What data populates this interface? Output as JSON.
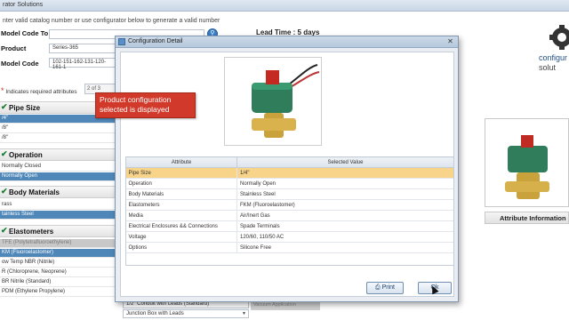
{
  "window": {
    "title": "rator Solutions"
  },
  "instructions": "nter valid catalog number or use configurator below to generate a valid number",
  "form": {
    "model_search_label": "Model Code To Search",
    "model_search_value": "",
    "product_label": "Product",
    "product_value": "Series-365",
    "model_code_label": "Model Code",
    "model_code_value": "102-151-162-131-120-161-1"
  },
  "lead_time": "Lead Time :  5 days",
  "required_note": "Indicates required attributes",
  "required_count": "2 of 3",
  "sections": {
    "pipe_size": {
      "title": "Pipe Size",
      "options": [
        "/4\"",
        "/8\"",
        "/8\""
      ],
      "selected": 0
    },
    "operation": {
      "title": "Operation",
      "options": [
        "Normally Closed",
        "Normally Open"
      ],
      "selected": 1
    },
    "body_materials": {
      "title": "Body Materials",
      "options": [
        "rass",
        "tainless Steel"
      ],
      "selected": 1
    },
    "elastometers": {
      "title": "Elastometers",
      "options": [
        "TFE (Polytetrafluoroethylene)",
        "KM (Fluoroelastomer)",
        "ow Temp NBR (Nitrile)",
        "R (Chloroprene, Neoprene)",
        "BR Nitrile (Standard)",
        "PDM (Ethylene Propylene)"
      ],
      "selected": 1,
      "disabled": 0
    }
  },
  "callout": "Product configuration selected is displayed",
  "brand": {
    "line1": "configur",
    "line2": "solut"
  },
  "attribute_info_label": "Attribute Information",
  "bottom": {
    "select1": "1/2\" Conduit with Leads (Standard)",
    "select2": "Junction Box with Leads",
    "vacuum": "Vacuum Application"
  },
  "dialog": {
    "title": "Configuration Detail",
    "close": "✕",
    "col_attribute": "Attribute",
    "col_value": "Selected Value",
    "rows": [
      {
        "attr": "Pipe Size",
        "value": "1/4\""
      },
      {
        "attr": "Operation",
        "value": "Normally Open"
      },
      {
        "attr": "Body Materials",
        "value": "Stainless Steel"
      },
      {
        "attr": "Elastometers",
        "value": "FKM (Fluoroelastomer)"
      },
      {
        "attr": "Media",
        "value": "Air/Inert Gas"
      },
      {
        "attr": "Electrical Enclosures && Connections",
        "value": "Spade Terminals"
      },
      {
        "attr": "Voltage",
        "value": "120/60, 110/50 AC"
      },
      {
        "attr": "Options",
        "value": "Silicone Free"
      }
    ],
    "print_label": "Print",
    "ok_label": "Ok"
  },
  "colors": {
    "selected_row": "#4e87b8",
    "highlight": "#f7d48a",
    "callout": "#d13a2b"
  }
}
